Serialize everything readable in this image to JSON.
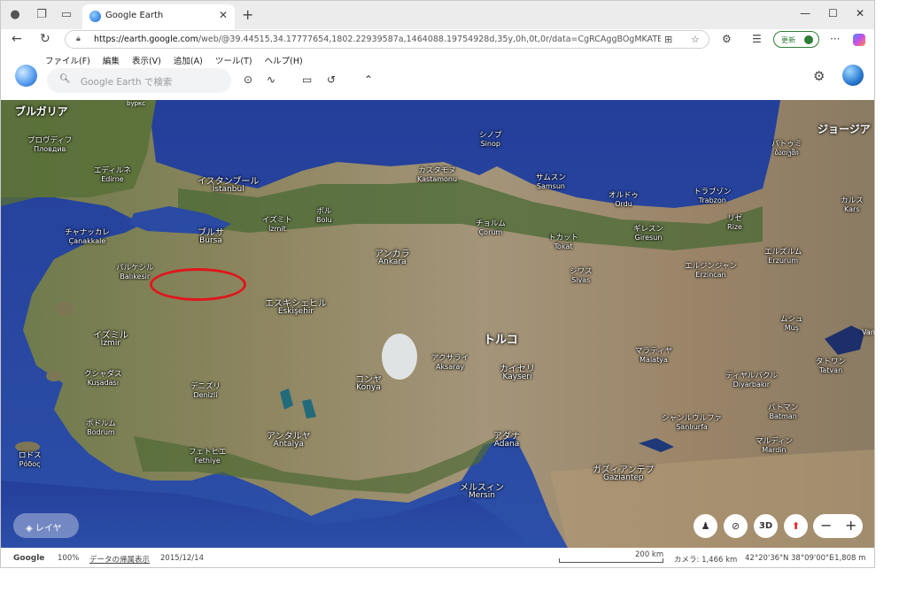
{
  "browser": {
    "tab_title": "Google Earth",
    "url_host": "https://earth.google.com",
    "url_path": "/web/@39.44515,34.17777654,1802.22939587a,1464088.19754928d,35y,0h,0t,0r/data=CgRCAggBOgMKATBCAggASg...",
    "update_label": "更新"
  },
  "earth": {
    "menus": [
      "ファイル(F)",
      "編集",
      "表示(V)",
      "追加(A)",
      "ツール(T)",
      "ヘルプ(H)"
    ],
    "search_placeholder": "Google Earth で検索"
  },
  "map": {
    "region_labels": {
      "bulgaria": "ブルガリア",
      "georgia": "ジョージア",
      "bulgaria_tag": "bypкс"
    },
    "cities": [
      {
        "jp": "プロヴディフ",
        "en": "Пловдив",
        "size": "sm"
      },
      {
        "jp": "エディルネ",
        "en": "Edirne",
        "size": "sm"
      },
      {
        "jp": "イスタンブール",
        "en": "İstanbul",
        "size": "med"
      },
      {
        "jp": "イズミト",
        "en": "İzmit",
        "size": "sm"
      },
      {
        "jp": "チャナッカレ",
        "en": "Çanakkale",
        "size": "sm"
      },
      {
        "jp": "ブルサ",
        "en": "Bursa",
        "size": "med"
      },
      {
        "jp": "バルケシル",
        "en": "Balıkesir",
        "size": "sm"
      },
      {
        "jp": "イズミル",
        "en": "İzmir",
        "size": "med"
      },
      {
        "jp": "クシャダス",
        "en": "Kuşadası",
        "size": "sm"
      },
      {
        "jp": "デニズリ",
        "en": "Denizli",
        "size": "sm"
      },
      {
        "jp": "ボドルム",
        "en": "Bodrum",
        "size": "sm"
      },
      {
        "jp": "フェトヒエ",
        "en": "Fethiye",
        "size": "sm"
      },
      {
        "jp": "ロドス",
        "en": "Ρόδος",
        "size": "sm"
      },
      {
        "jp": "アンタルヤ",
        "en": "Antalya",
        "size": "med"
      },
      {
        "jp": "エスキシェヒル",
        "en": "Eskişehir",
        "size": "med"
      },
      {
        "jp": "ボル",
        "en": "Bolu",
        "size": "sm"
      },
      {
        "jp": "アンカラ",
        "en": "Ankara",
        "size": "med"
      },
      {
        "jp": "カスタモヌ",
        "en": "Kastamonu",
        "size": "sm"
      },
      {
        "jp": "シノプ",
        "en": "Sinop",
        "size": "sm"
      },
      {
        "jp": "チョルム",
        "en": "Çorum",
        "size": "sm"
      },
      {
        "jp": "サムスン",
        "en": "Samsun",
        "size": "sm"
      },
      {
        "jp": "オルドゥ",
        "en": "Ordu",
        "size": "sm"
      },
      {
        "jp": "トカット",
        "en": "Tokat",
        "size": "sm"
      },
      {
        "jp": "ギレスン",
        "en": "Giresun",
        "size": "sm"
      },
      {
        "jp": "トラブゾン",
        "en": "Trabzon",
        "size": "sm"
      },
      {
        "jp": "リゼ",
        "en": "Rize",
        "size": "sm"
      },
      {
        "jp": "バトゥミ",
        "en": "ბათუმი",
        "size": "sm"
      },
      {
        "jp": "カルス",
        "en": "Kars",
        "size": "sm"
      },
      {
        "jp": "エルズルム",
        "en": "Erzurum",
        "size": "sm"
      },
      {
        "jp": "エルジンジャン",
        "en": "Erzincan",
        "size": "sm"
      },
      {
        "jp": "シワス",
        "en": "Sivas",
        "size": "sm"
      },
      {
        "jp": "アクサライ",
        "en": "Aksaray",
        "size": "sm"
      },
      {
        "jp": "コンヤ",
        "en": "Konya",
        "size": "med"
      },
      {
        "jp": "カイセリ",
        "en": "Kayseri",
        "size": "med"
      },
      {
        "jp": "アダナ",
        "en": "Adana",
        "size": "med"
      },
      {
        "jp": "メルスィン",
        "en": "Mersin",
        "size": "med"
      },
      {
        "jp": "ガズィアンテプ",
        "en": "Gaziantep",
        "size": "med"
      },
      {
        "jp": "マラティヤ",
        "en": "Malatya",
        "size": "sm"
      },
      {
        "jp": "ディヤルバクル",
        "en": "Diyarbakır",
        "size": "sm"
      },
      {
        "jp": "ムシュ",
        "en": "Muş",
        "size": "sm"
      },
      {
        "jp": "タトワン",
        "en": "Tatvan",
        "size": "sm"
      },
      {
        "jp": "バトマン",
        "en": "Batman",
        "size": "sm"
      },
      {
        "jp": "シャンルウルファ",
        "en": "Şanlıurfa",
        "size": "sm"
      },
      {
        "jp": "マルディン",
        "en": "Mardin",
        "size": "sm"
      }
    ],
    "country_label": "トルコ",
    "van_label": "Van",
    "highlight": "イスタンブール"
  },
  "controls": {
    "layers_label": "レイヤ",
    "three_d": "3D"
  },
  "status": {
    "brand": "Google",
    "zoom": "100%",
    "attribution": "データの帰属表示",
    "date": "2015/12/14",
    "scale": "200 km",
    "camera": "カメラ: 1,466 km",
    "coords": "42°20'36\"N 38°09'00\"E",
    "elevation": "-1,808 m"
  }
}
